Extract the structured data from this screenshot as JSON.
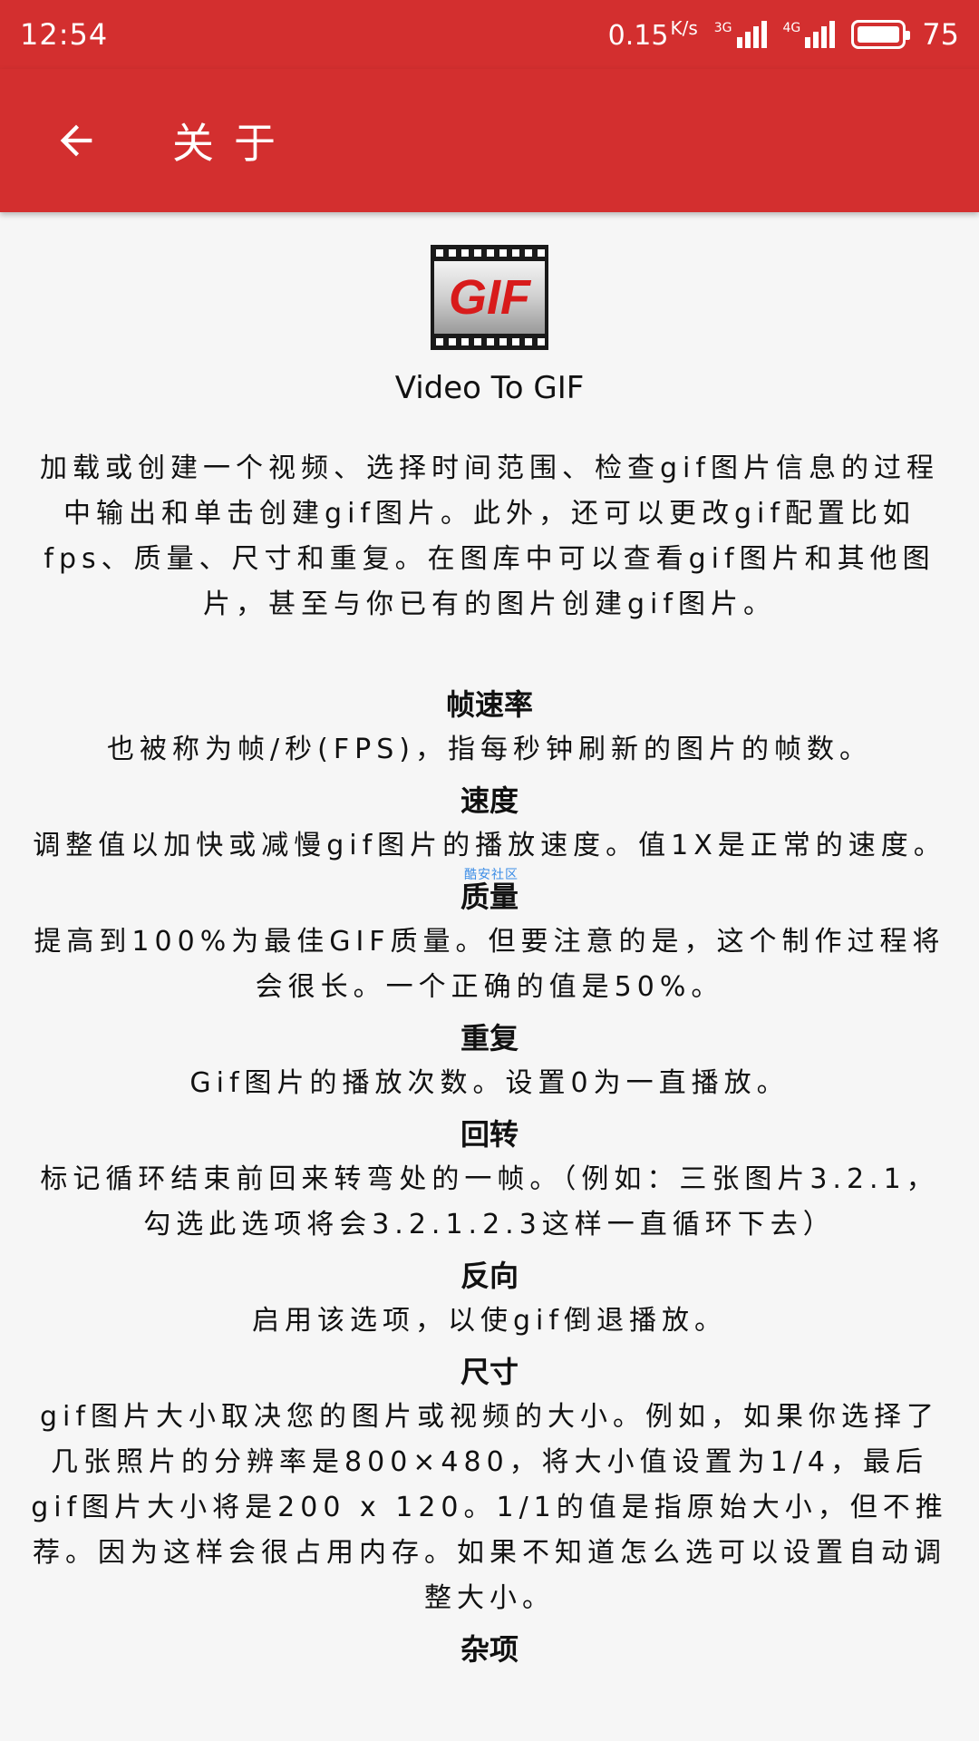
{
  "status_bar": {
    "time": "12:54",
    "speed": "0.15",
    "speed_unit": "K/s",
    "net1": "3G",
    "net2": "4G",
    "battery": "75"
  },
  "toolbar": {
    "title": "关于"
  },
  "logo_text": "GIF",
  "app_name": "Video To GIF",
  "intro": "加载或创建一个视频、选择时间范围、检查gif图片信息的过程中输出和单击创建gif图片。此外，还可以更改gif配置比如fps、质量、尺寸和重复。在图库中可以查看gif图片和其他图片，甚至与你已有的图片创建gif图片。",
  "sections": [
    {
      "title": "帧速率",
      "body": "也被称为帧/秒(FPS)，指每秒钟刷新的图片的帧数。"
    },
    {
      "title": "速度",
      "body": "调整值以加快或减慢gif图片的播放速度。值1X是正常的速度。"
    },
    {
      "title": "质量",
      "body": "提高到100%为最佳GIF质量。但要注意的是，这个制作过程将会很长。一个正确的值是50%。"
    },
    {
      "title": "重复",
      "body": "Gif图片的播放次数。设置0为一直播放。"
    },
    {
      "title": "回转",
      "body": "标记循环结束前回来转弯处的一帧。（例如：三张图片3.2.1，勾选此选项将会3.2.1.2.3这样一直循环下去）"
    },
    {
      "title": "反向",
      "body": "启用该选项，以使gif倒退播放。"
    },
    {
      "title": "尺寸",
      "body": "gif图片大小取决您的图片或视频的大小。例如，如果你选择了几张照片的分辨率是800×480，将大小值设置为1/4，最后gif图片大小将是200 x 120。1/1的值是指原始大小，但不推荐。因为这样会很占用内存。如果不知道怎么选可以设置自动调整大小。"
    }
  ],
  "last_section_title": "杂项",
  "watermark": "酷安社区",
  "colors": {
    "primary": "#d32f2f",
    "background": "#f6f6f6"
  }
}
